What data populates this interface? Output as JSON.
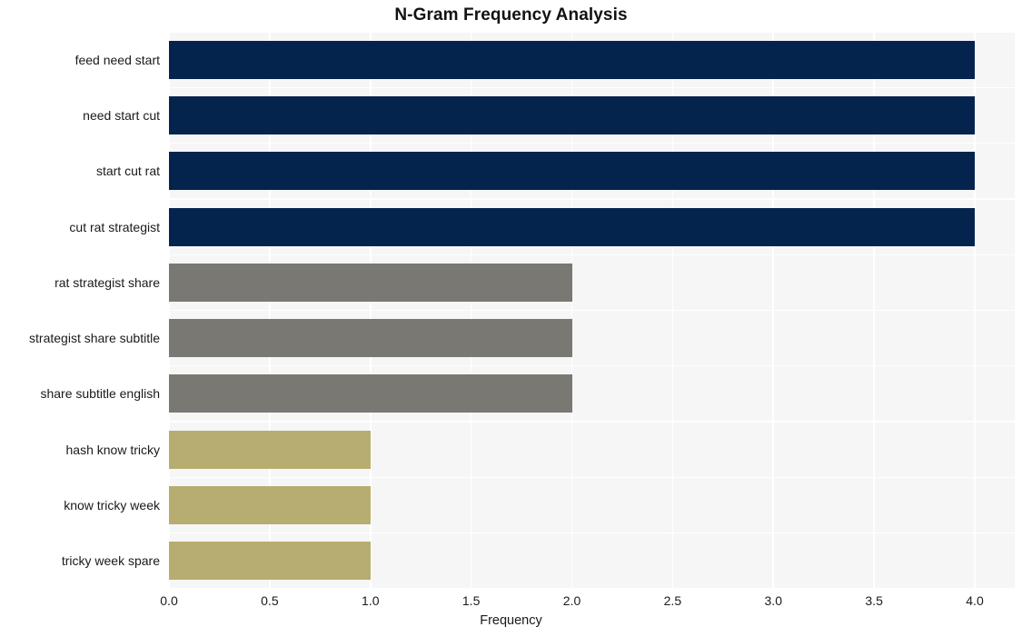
{
  "chart_data": {
    "type": "bar",
    "orientation": "horizontal",
    "title": "N-Gram Frequency Analysis",
    "xlabel": "Frequency",
    "ylabel": "",
    "xlim": [
      0.0,
      4.0
    ],
    "xticks": [
      "0.0",
      "0.5",
      "1.0",
      "1.5",
      "2.0",
      "2.5",
      "3.0",
      "3.5",
      "4.0"
    ],
    "xtick_values": [
      0.0,
      0.5,
      1.0,
      1.5,
      2.0,
      2.5,
      3.0,
      3.5,
      4.0
    ],
    "grid": true,
    "grid_color": "#ffffff",
    "plot_background": "#f6f6f7",
    "legend": "none",
    "categories": [
      "feed need start",
      "need start cut",
      "start cut rat",
      "cut rat strategist",
      "rat strategist share",
      "strategist share subtitle",
      "share subtitle english",
      "hash know tricky",
      "know tricky week",
      "tricky week spare"
    ],
    "values": [
      4,
      4,
      4,
      4,
      2,
      2,
      2,
      1,
      1,
      1
    ],
    "bar_colors": [
      "#04234d",
      "#04234d",
      "#04234d",
      "#04234d",
      "#7a7873",
      "#7a7873",
      "#7a7873",
      "#b8ad71",
      "#b8ad71",
      "#b8ad71"
    ],
    "palette": {
      "navy": "#04234d",
      "gray": "#7a7873",
      "khaki": "#b8ad71"
    }
  }
}
